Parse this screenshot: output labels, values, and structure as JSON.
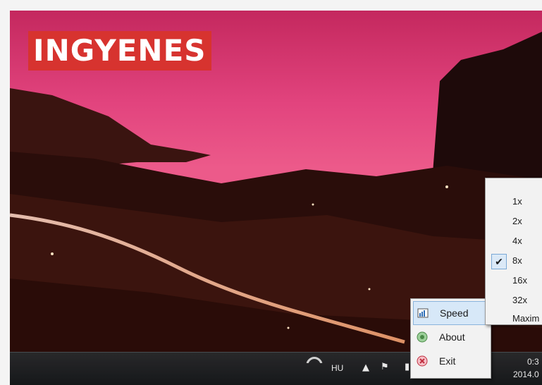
{
  "badge": {
    "text": "INGYENES"
  },
  "context_menu": {
    "items": [
      {
        "label": "Speed",
        "icon": "speed-icon",
        "highlighted": true
      },
      {
        "label": "About",
        "icon": "about-icon"
      },
      {
        "label": "Exit",
        "icon": "exit-icon"
      }
    ]
  },
  "speed_menu": {
    "items": [
      "1x",
      "2x",
      "4x",
      "8x",
      "16x",
      "32x",
      "Maxim"
    ],
    "selected": "8x"
  },
  "taskbar": {
    "language": "HU",
    "time": "0:3",
    "date": "2014.0"
  },
  "colors": {
    "badge_bg": "#d7332f",
    "menu_bg": "#f2f2f2",
    "highlight": "#d7e8f8"
  }
}
